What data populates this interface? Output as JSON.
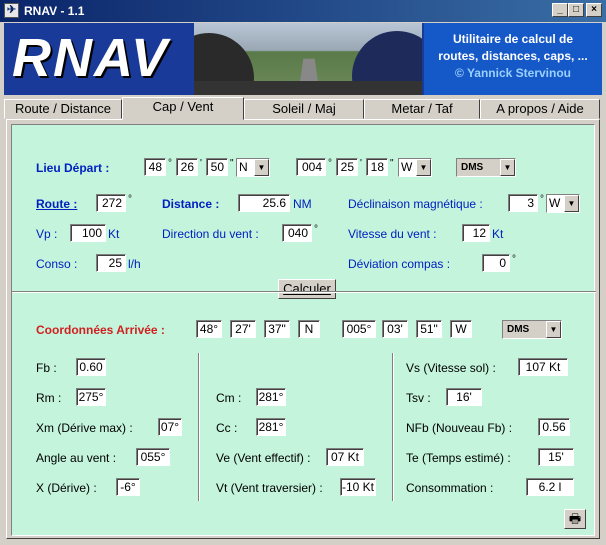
{
  "window": {
    "title": "RNAV - 1.1",
    "minimize": "_",
    "maximize": "□",
    "close": "×"
  },
  "banner": {
    "logo": "RNAV",
    "line1": "Utilitaire de calcul de",
    "line2": "routes, distances, caps, ...",
    "author": "© Yannick Stervinou"
  },
  "tabs": [
    "Route / Distance",
    "Cap / Vent",
    "Soleil / Maj",
    "Metar / Taf",
    "A propos / Aide"
  ],
  "depart": {
    "label": "Lieu Départ :",
    "lat_deg": "48",
    "lat_min": "26",
    "lat_sec": "50",
    "lat_hem": "N",
    "lon_deg": "004",
    "lon_min": "25",
    "lon_sec": "18",
    "lon_hem": "W",
    "format": "DMS"
  },
  "inputs": {
    "route_label": "Route :",
    "route": "272",
    "deg": "°",
    "distance_label": "Distance :",
    "distance": "25.6",
    "distance_unit": "NM",
    "declinaison_label": "Déclinaison magnétique :",
    "declinaison": "3",
    "declinaison_dir": "W",
    "vp_label": "Vp :",
    "vp": "100",
    "vp_unit": "Kt",
    "dir_vent_label": "Direction du vent :",
    "dir_vent": "040",
    "vit_vent_label": "Vitesse du vent :",
    "vit_vent": "12",
    "vit_vent_unit": "Kt",
    "conso_label": "Conso :",
    "conso": "25",
    "conso_unit": "l/h",
    "deviation_label": "Déviation compas :",
    "deviation": "0",
    "calculer": "Calculer"
  },
  "arrivee": {
    "label": "Coordonnées Arrivée :",
    "lat_deg": "48°",
    "lat_min": "27'",
    "lat_sec": "37\"",
    "lat_hem": "N",
    "lon_deg": "005°",
    "lon_min": "03'",
    "lon_sec": "51\"",
    "lon_hem": "W",
    "format": "DMS"
  },
  "results": {
    "fb_label": "Fb :",
    "fb": "0.60",
    "rm_label": "Rm :",
    "rm": "275°",
    "xm_label": "Xm (Dérive max) :",
    "xm": "07°",
    "angle_label": "Angle au vent :",
    "angle": "055°",
    "x_label": "X (Dérive) :",
    "x": "-6°",
    "cm_label": "Cm :",
    "cm": "281°",
    "cc_label": "Cc :",
    "cc": "281°",
    "ve_label": "Ve (Vent effectif) :",
    "ve": "07 Kt",
    "vt_label": "Vt (Vent traversier) :",
    "vt": "-10 Kt",
    "vs_label": "Vs (Vitesse sol) :",
    "vs": "107 Kt",
    "tsv_label": "Tsv :",
    "tsv": "16'",
    "nfb_label": "NFb (Nouveau Fb) :",
    "nfb": "0.56",
    "te_label": "Te (Temps estimé) :",
    "te": "15'",
    "consommation_label": "Consommation :",
    "consommation": "6.2 l"
  },
  "print_icon": "printer-icon",
  "colors": {
    "panel": "#c4f4dc",
    "title": "#0a246a",
    "label_blue": "#0020c0",
    "label_red": "#d02020"
  }
}
